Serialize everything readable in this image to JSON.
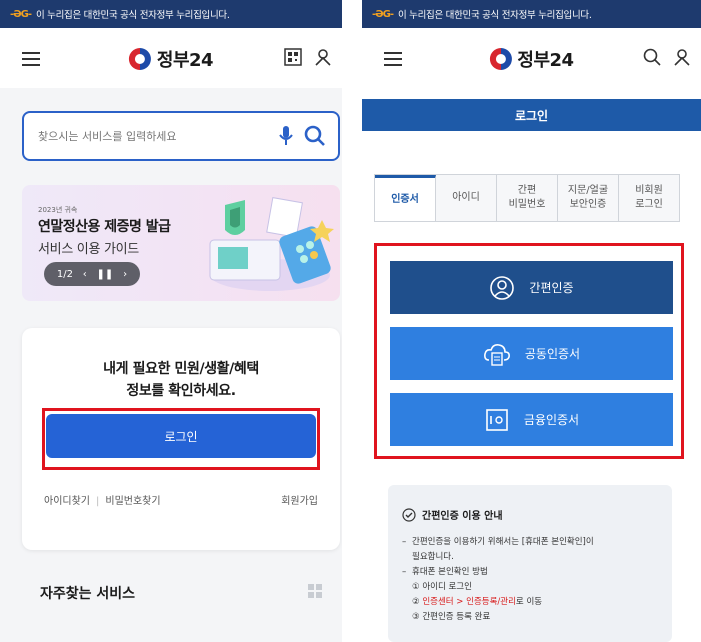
{
  "notice": {
    "flag": "-ƏG-",
    "text": "이 누리집은 대한민국 공식 전자정부 누리집입니다."
  },
  "logo": {
    "text": "정부24"
  },
  "left": {
    "search": {
      "placeholder": "찾으시는 서비스를 입력하세요"
    },
    "banner": {
      "small": "2023년 귀속",
      "title": "연말정산용 제증명 발급",
      "subtitle": "서비스 이용 가이드",
      "pager_page": "1/2",
      "prev": "‹",
      "pause": "❚❚",
      "next": "›"
    },
    "login_card": {
      "prompt_line1": "내게 필요한 민원/생활/혜택",
      "prompt_line2": "정보를 확인하세요.",
      "login_button": "로그인",
      "find_id": "아이디찾기",
      "find_pw": "비밀번호찾기",
      "join": "회원가입"
    },
    "frequent": {
      "title": "자주찾는 서비스"
    }
  },
  "right": {
    "page_title": "로그인",
    "tabs": [
      {
        "label": "인증서",
        "active": true
      },
      {
        "label": "아이디",
        "active": false
      },
      {
        "label": "간편\n비밀번호",
        "active": false
      },
      {
        "label": "지문/얼굴\n보안인증",
        "active": false
      },
      {
        "label": "비회원\n로그인",
        "active": false
      }
    ],
    "methods": [
      {
        "label": "간편인증",
        "icon": "person-circle-icon"
      },
      {
        "label": "공동인증서",
        "icon": "cloud-document-icon"
      },
      {
        "label": "금융인증서",
        "icon": "safe-icon"
      }
    ],
    "guide": {
      "title": "간편인증 이용 안내",
      "line1": "간편인증을 이용하기 위해서는 [휴대폰 본인확인]이",
      "line1b": "필요합니다.",
      "line2": "휴대폰 본인확인 방법",
      "step1": "① 아이디 로그인",
      "step2_num": "② ",
      "step2_red": "인증센터 > 인증등록/관리",
      "step2_tail": "로 이동",
      "step3": "③ 간편인증 등록 완료"
    }
  },
  "colors": {
    "notice_bg": "#1e3a6e",
    "primary": "#2563d6",
    "highlight": "#e0141e",
    "title_bar": "#1e5aa8"
  }
}
